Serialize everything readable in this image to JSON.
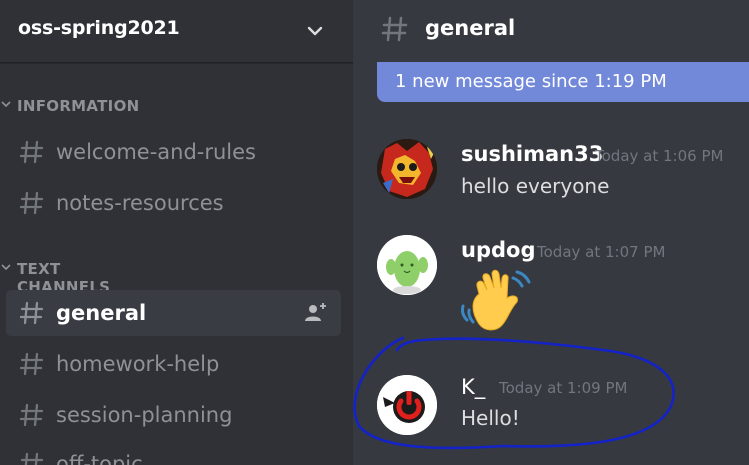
{
  "server": {
    "name": "oss-spring2021",
    "chevron_icon": "chevron-down-icon"
  },
  "categories": [
    {
      "label": "INFORMATION"
    },
    {
      "label": "TEXT CHANNELS"
    }
  ],
  "channels": [
    {
      "name": "welcome-and-rules"
    },
    {
      "name": "notes-resources"
    },
    {
      "name": "general",
      "selected": true,
      "action_icon": "add-member-icon"
    },
    {
      "name": "homework-help"
    },
    {
      "name": "session-planning"
    },
    {
      "name": "off-topic"
    }
  ],
  "header": {
    "channel_name": "general",
    "icon": "hash-icon"
  },
  "new_messages_bar": {
    "text": "1 new message since 1:19 PM"
  },
  "messages": [
    {
      "author": "sushiman33",
      "timestamp": "Today at 1:06 PM",
      "content": "hello everyone",
      "avatar": "red-character-avatar"
    },
    {
      "author": "updog",
      "timestamp": "Today at 1:07 PM",
      "content": "wave-emoji",
      "avatar": "cactus-avatar"
    },
    {
      "author": "K_",
      "timestamp": "Today at 1:09 PM",
      "content": "Hello!",
      "avatar": "power-button-avatar"
    }
  ],
  "colors": {
    "sidebar_bg": "#2f3136",
    "main_bg": "#36393f",
    "blurple": "#7289da",
    "annotation_blue": "#1322c9",
    "muted_text": "#8e9297"
  }
}
